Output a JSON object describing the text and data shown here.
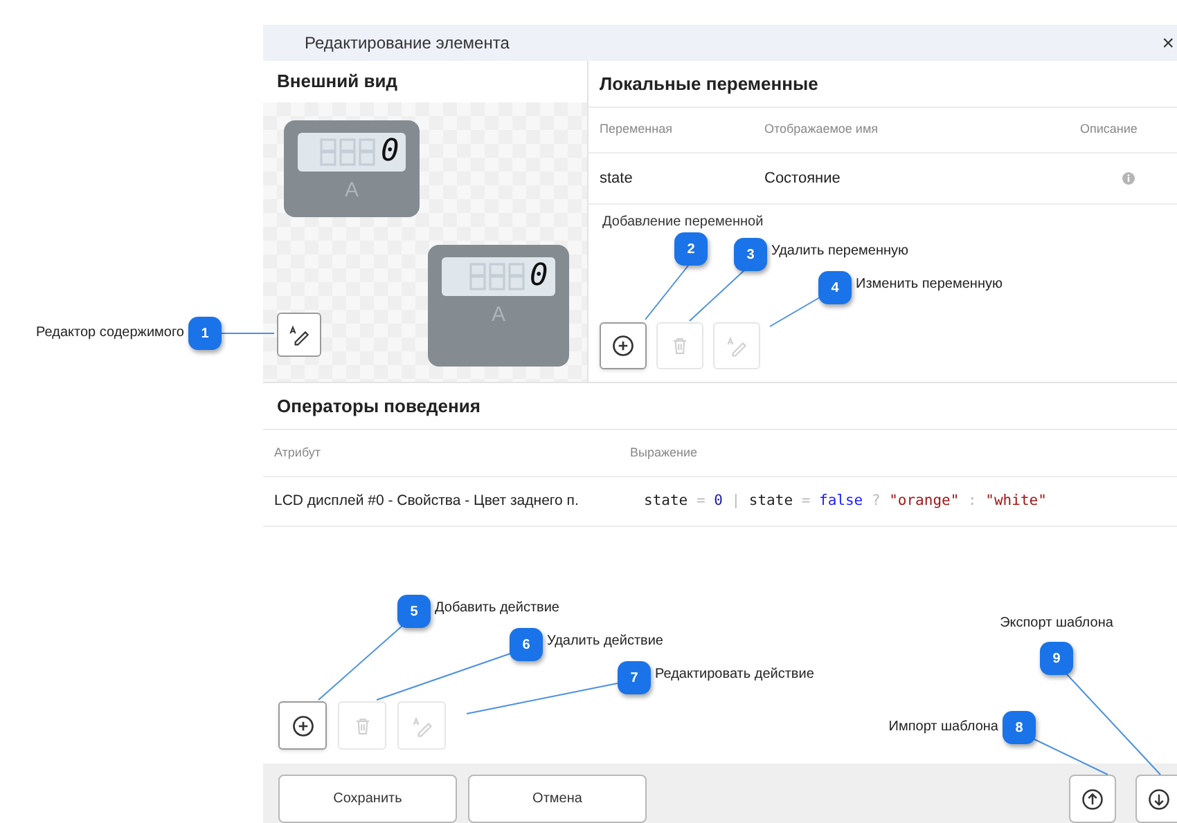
{
  "window": {
    "title": "Редактирование элемента",
    "close": "×"
  },
  "appearance": {
    "heading": "Внешний вид",
    "displays": [
      {
        "value": "0",
        "unit": "A"
      },
      {
        "value": "0",
        "unit": "A"
      }
    ],
    "editor_button": {
      "disabled": false
    }
  },
  "local_variables": {
    "heading": "Локальные переменные",
    "columns": [
      "Переменная",
      "Отображаемое имя",
      "Описание"
    ],
    "rows": [
      {
        "variable": "state",
        "display_name": "Состояние"
      }
    ],
    "add_label": "Добавление переменной",
    "buttons": [
      {
        "kind": "add",
        "disabled": false
      },
      {
        "kind": "delete",
        "disabled": true
      },
      {
        "kind": "edit",
        "disabled": true
      }
    ]
  },
  "behavior": {
    "heading": "Операторы поведения",
    "columns": [
      "Атрибут",
      "Выражение"
    ],
    "rows": [
      {
        "attribute": "LCD дисплей #0 - Свойства - Цвет заднего п.",
        "expression": [
          {
            "kind": "ident",
            "text": "state"
          },
          {
            "kind": "op",
            "text": "="
          },
          {
            "kind": "number",
            "text": "0"
          },
          {
            "kind": "op",
            "text": "|"
          },
          {
            "kind": "ident",
            "text": "state"
          },
          {
            "kind": "op",
            "text": "="
          },
          {
            "kind": "keyword",
            "text": "false"
          },
          {
            "kind": "op",
            "text": "?"
          },
          {
            "kind": "string",
            "text": "\"orange\""
          },
          {
            "kind": "op",
            "text": ":"
          },
          {
            "kind": "string",
            "text": "\"white\""
          }
        ]
      }
    ],
    "buttons": [
      {
        "kind": "add",
        "disabled": false
      },
      {
        "kind": "delete",
        "disabled": true
      },
      {
        "kind": "edit",
        "disabled": true
      }
    ]
  },
  "footer": {
    "buttons": [
      "Сохранить",
      "Отмена"
    ],
    "icon_buttons": [
      {
        "kind": "import"
      },
      {
        "kind": "export"
      }
    ]
  },
  "callouts": [
    {
      "number": "1",
      "label": "Редактор содержимого"
    },
    {
      "number": "2"
    },
    {
      "number": "3",
      "label": "Удалить переменную"
    },
    {
      "number": "4",
      "label": "Изменить переменную"
    },
    {
      "number": "5",
      "label": "Добавить действие"
    },
    {
      "number": "6",
      "label": "Удалить действие"
    },
    {
      "number": "7",
      "label": "Редактировать действие"
    },
    {
      "number": "8",
      "label": "Импорт шаблона"
    },
    {
      "number": "9",
      "label": "Экспорт шаблона"
    }
  ]
}
